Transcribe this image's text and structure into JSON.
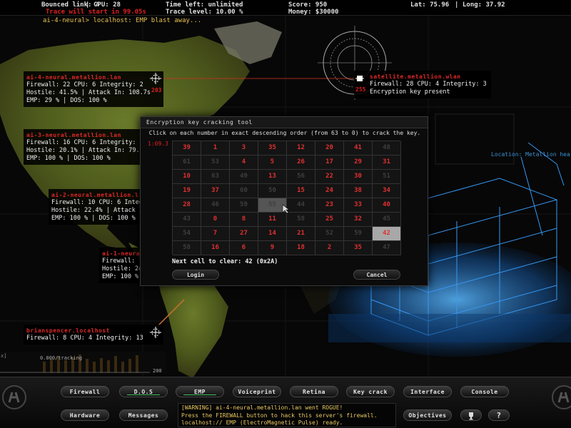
{
  "hud": {
    "bounced": "Bounced link: 4",
    "cpu": "CPU: 28",
    "time_left": "Time left: unlimited",
    "score": "Score: 950",
    "lat": "Lat: 75.96",
    "long": "Long: 37.92",
    "trace_start": "Trace will start in 99.05s",
    "trace_level": "Trace level: 10.00 %",
    "money": "Money: $30000",
    "prompt": "ai-4-neural> localhost: EMP blast away..."
  },
  "nodes": [
    {
      "name": "ai-4-neural.metallion.lan",
      "lines": [
        "Firewall: 22 CPU: 6 Integrity: 2",
        "Hostile: 41.5% | Attack In: 108.7s",
        "EMP: 29 % | DOS: 100 %"
      ],
      "marker": "203"
    },
    {
      "name": "ai-3-neural.metallion.lan",
      "lines": [
        "Firewall: 16 CPU: 6 Integrity: 2",
        "Hostile: 20.1% | Attack In: 79.7s",
        "EMP: 100 % | DOS: 100 %"
      ]
    },
    {
      "name": "ai-2-neural.metallion.l",
      "lines": [
        "Firewall: 10 CPU: 6 Integri",
        "Hostile: 22.4% | Attack In:",
        "EMP: 100 % | DOS: 100 %"
      ]
    },
    {
      "name": "ai-1-neura",
      "lines": [
        "Firewall: ",
        "Hostile: 24",
        "EMP: 100 %"
      ]
    },
    {
      "name": "brianspencer.localhost",
      "lines": [
        "Firewall: 8 CPU: 4 Integrity: 13"
      ]
    },
    {
      "name": "satellite.metallion.wlan",
      "lines": [
        "Firewall: 28 CPU: 4 Integrity: 3",
        "Encryption key present"
      ],
      "marker": "255"
    }
  ],
  "modal": {
    "title": "Encryption key cracking tool",
    "instruction": "Click on each number in exact descending order (from 63 to 0) to crack the key.",
    "timer": "1:09.3",
    "next": "Next cell to clear: 42 (0x2A)",
    "login": "Login",
    "cancel": "Cancel",
    "grid": [
      [
        39,
        1,
        3,
        35,
        12,
        20,
        41,
        48
      ],
      [
        61,
        53,
        4,
        5,
        26,
        17,
        29,
        31
      ],
      [
        10,
        63,
        49,
        13,
        56,
        22,
        30,
        51
      ],
      [
        19,
        37,
        60,
        50,
        15,
        24,
        38,
        34
      ],
      [
        28,
        46,
        59,
        55,
        44,
        23,
        33,
        40
      ],
      [
        43,
        0,
        8,
        11,
        58,
        25,
        32,
        45
      ],
      [
        54,
        7,
        27,
        14,
        21,
        52,
        59,
        42
      ],
      [
        58,
        16,
        6,
        9,
        18,
        2,
        35,
        47
      ]
    ],
    "cleared_below": 42
  },
  "location": "Location: Metallion hea",
  "graph": {
    "label": "0.000/tracking",
    "max": "200"
  },
  "buttons": {
    "firewall": "Firewall",
    "dos": "D.O.S",
    "emp": "EMP",
    "voiceprint": "Voiceprint",
    "retina": "Retina",
    "keycrack": "Key crack",
    "interface": "Interface",
    "console": "Console",
    "hardware": "Hardware",
    "messages": "Messages",
    "objectives": "Objectives",
    "help": "?"
  },
  "console_lines": [
    "[WARNING] ai-4-neural.metallion.lan went ROGUE!",
    "Press the FIREWALL button to hack this server's firewall.",
    "localhost:// EMP (ElectroMagnetic Pulse) ready."
  ],
  "colors": {
    "accent_red": "#e02828",
    "console_yellow": "#e8c860",
    "holo_blue": "#2a8ce0"
  }
}
